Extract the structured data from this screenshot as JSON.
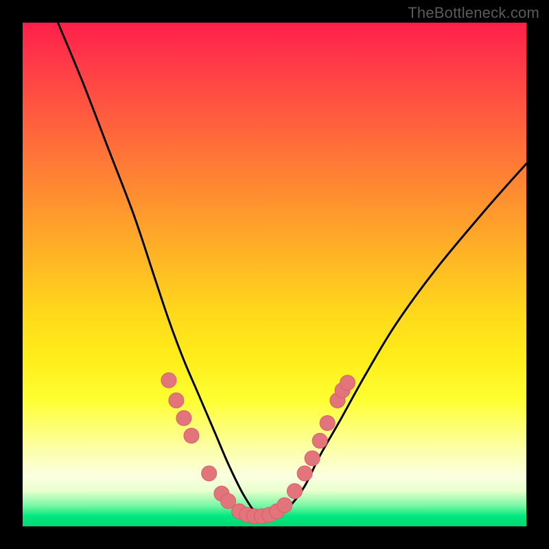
{
  "watermark": "TheBottleneck.com",
  "colors": {
    "frame_bg": "#000000",
    "dot_fill": "#e2747c",
    "dot_stroke": "#d85f6a",
    "curve_stroke": "#000000"
  },
  "chart_data": {
    "type": "line",
    "title": "",
    "xlabel": "",
    "ylabel": "",
    "xlim": [
      0,
      100
    ],
    "ylim": [
      0,
      100
    ],
    "grid": false,
    "legend": false,
    "note": "No axis tick labels or numeric data labels are visible. Y represents bottleneck percentage (high=red, low=green). X represents a hardware range. Curve is a V shape with minimum near x≈47. Values are estimated from pixel positions on a 0–100 scale.",
    "series": [
      {
        "name": "bottleneck-curve",
        "x": [
          7,
          12,
          17,
          22,
          26,
          29,
          32,
          35,
          38,
          41,
          44,
          47,
          50,
          53,
          56,
          59,
          63,
          68,
          74,
          82,
          92,
          100
        ],
        "y": [
          100,
          88,
          75,
          62,
          50,
          41,
          33,
          26,
          19,
          12,
          6,
          2,
          2,
          4,
          8,
          14,
          21,
          30,
          40,
          51,
          63,
          72
        ]
      }
    ],
    "data_points": [
      {
        "x": 29.0,
        "y": 29.0
      },
      {
        "x": 30.5,
        "y": 25.0
      },
      {
        "x": 32.0,
        "y": 21.5
      },
      {
        "x": 33.5,
        "y": 18.0
      },
      {
        "x": 37.0,
        "y": 10.5
      },
      {
        "x": 39.5,
        "y": 6.5
      },
      {
        "x": 40.8,
        "y": 5.0
      },
      {
        "x": 43.0,
        "y": 3.0
      },
      {
        "x": 44.5,
        "y": 2.3
      },
      {
        "x": 46.0,
        "y": 2.0
      },
      {
        "x": 47.5,
        "y": 2.0
      },
      {
        "x": 49.0,
        "y": 2.3
      },
      {
        "x": 50.5,
        "y": 3.0
      },
      {
        "x": 52.0,
        "y": 4.2
      },
      {
        "x": 54.0,
        "y": 7.0
      },
      {
        "x": 56.0,
        "y": 10.5
      },
      {
        "x": 57.5,
        "y": 13.5
      },
      {
        "x": 59.0,
        "y": 17.0
      },
      {
        "x": 60.5,
        "y": 20.5
      },
      {
        "x": 62.5,
        "y": 25.0
      },
      {
        "x": 63.5,
        "y": 27.0
      },
      {
        "x": 64.5,
        "y": 28.5
      }
    ],
    "dot_radius_px": 11
  }
}
